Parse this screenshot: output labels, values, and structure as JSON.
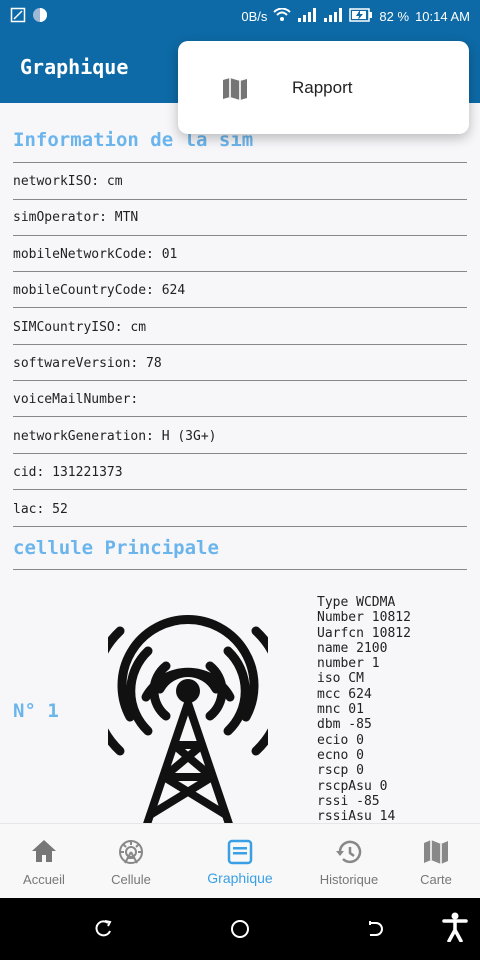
{
  "statusbar": {
    "speed": "0B/s",
    "battery": "82 %",
    "time": "10:14 AM"
  },
  "appbar": {
    "title": "Graphique"
  },
  "menu": {
    "items": [
      {
        "label": "Rapport",
        "icon": "map-icon"
      }
    ]
  },
  "sim": {
    "title": "Information de la sim",
    "rows": [
      "networkISO: cm",
      "simOperator: MTN",
      "mobileNetworkCode: 01",
      "mobileCountryCode: 624",
      "SIMCountryISO: cm",
      "softwareVersion: 78",
      "voiceMailNumber:",
      "networkGeneration: H (3G+)",
      "cid: 131221373",
      "lac: 52"
    ]
  },
  "cell": {
    "title": "cellule Principale",
    "number": "N° 1",
    "details": [
      "Type WCDMA",
      "Number 10812",
      "Uarfcn 10812",
      "name 2100",
      "number 1",
      "iso CM",
      "mcc 624",
      "mnc 01",
      "dbm -85",
      "ecio 0",
      "ecno 0",
      "rscp 0",
      "rscpAsu 0",
      "rssi -85",
      "rssiAsu 14"
    ]
  },
  "bottomnav": {
    "items": [
      {
        "label": "Accueil",
        "icon": "home-icon"
      },
      {
        "label": "Cellule",
        "icon": "cell-icon"
      },
      {
        "label": "Graphique",
        "icon": "chart-icon",
        "active": true
      },
      {
        "label": "Historique",
        "icon": "history-icon"
      },
      {
        "label": "Carte",
        "icon": "map-icon"
      }
    ]
  },
  "colors": {
    "primary": "#0d6aa6",
    "accent": "#6bb5ec",
    "active_nav": "#3aa0e6"
  }
}
